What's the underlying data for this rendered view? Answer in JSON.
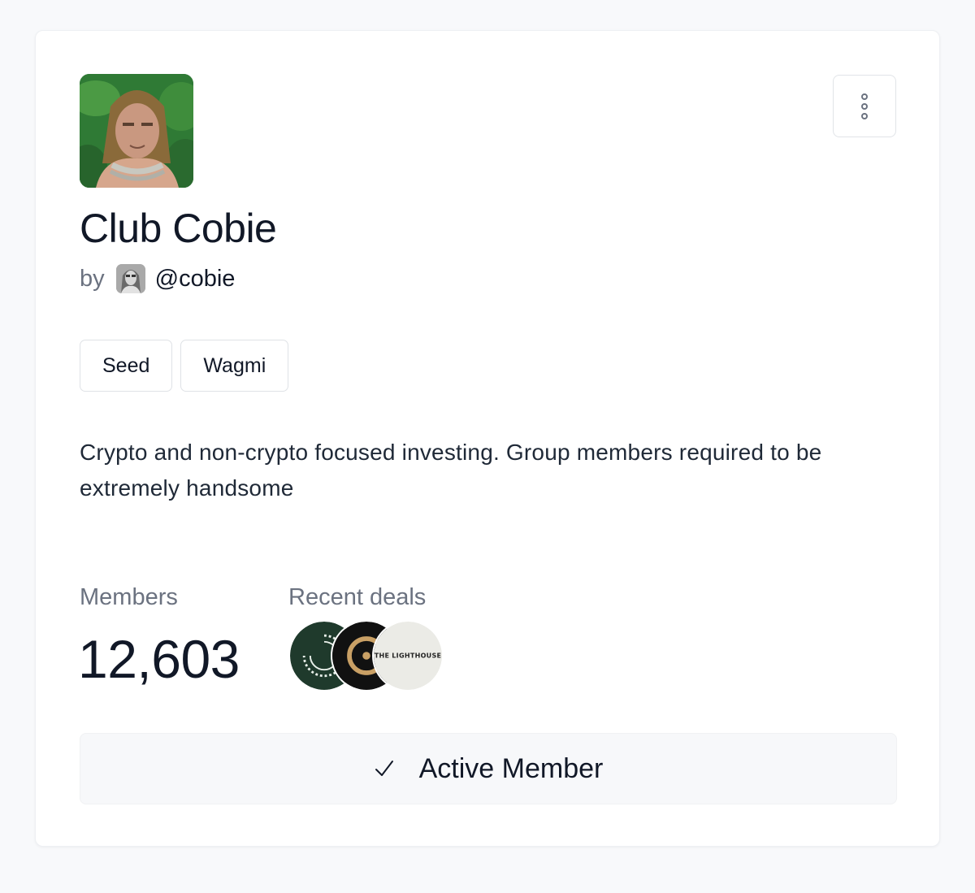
{
  "club": {
    "name": "Club Cobie",
    "by_label": "by",
    "owner_handle": "@cobie",
    "tags": [
      "Seed",
      "Wagmi"
    ],
    "description": "Crypto and non-crypto focused investing. Group members required to be extremely handsome"
  },
  "stats": {
    "members_label": "Members",
    "members_value": "12,603",
    "recent_deals_label": "Recent deals",
    "recent_deals": [
      {
        "icon": "dark-green-ring-logo"
      },
      {
        "icon": "black-gold-ring-logo"
      },
      {
        "icon": "the-lighthouse-logo",
        "text": "THE LIGHTHOUSE"
      }
    ]
  },
  "membership": {
    "status_label": "Active Member",
    "status_icon": "check-icon"
  },
  "menu": {
    "icon": "more-vertical-icon"
  },
  "colors": {
    "page_background": "#f8f9fb",
    "card_background": "#ffffff",
    "text_primary": "#111827",
    "text_secondary": "#6b7280",
    "status_button_background": "#f7f8fa"
  }
}
